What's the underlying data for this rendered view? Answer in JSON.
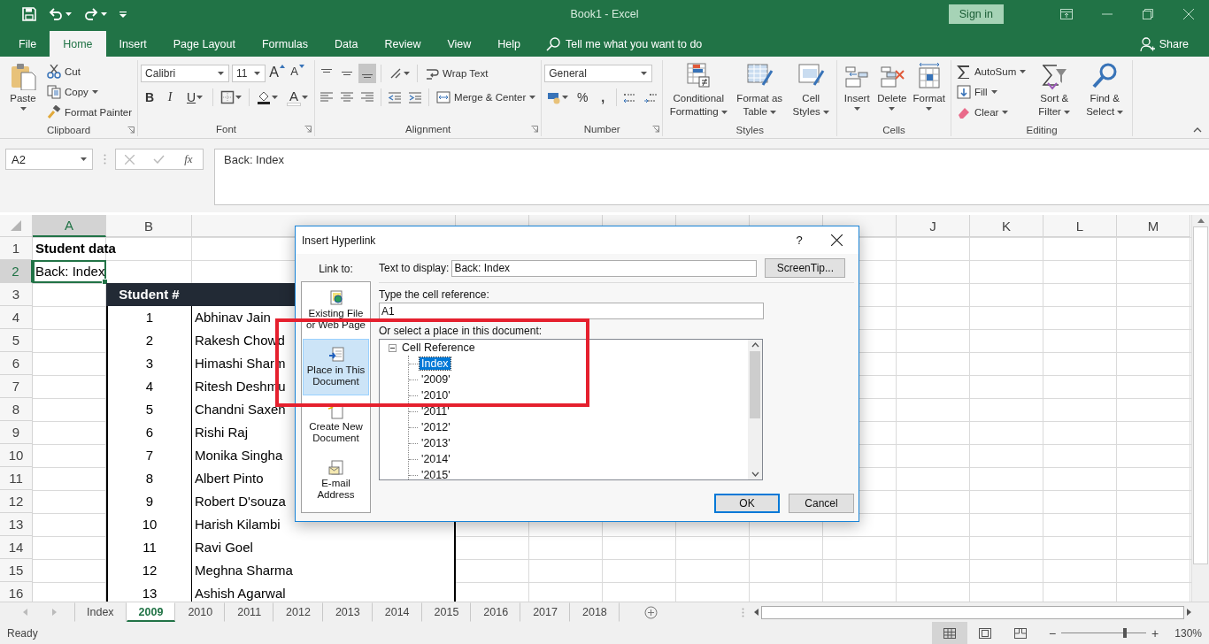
{
  "window": {
    "title": "Book1  -  Excel",
    "sign_in": "Sign in"
  },
  "menu_tabs": [
    {
      "label": "File",
      "selected": false
    },
    {
      "label": "Home",
      "selected": true
    },
    {
      "label": "Insert",
      "selected": false
    },
    {
      "label": "Page Layout",
      "selected": false
    },
    {
      "label": "Formulas",
      "selected": false
    },
    {
      "label": "Data",
      "selected": false
    },
    {
      "label": "Review",
      "selected": false
    },
    {
      "label": "View",
      "selected": false
    },
    {
      "label": "Help",
      "selected": false
    }
  ],
  "tell_me": {
    "placeholder": "Tell me what you want to do"
  },
  "share": "Share",
  "ribbon": {
    "clipboard": {
      "label": "Clipboard",
      "paste": "Paste",
      "cut": "Cut",
      "copy": "Copy",
      "format_painter": "Format Painter"
    },
    "font": {
      "label": "Font",
      "font_name": "Calibri",
      "font_size": "11",
      "grow": "A",
      "shrink": "A",
      "bold": "B",
      "italic": "I",
      "underline": "U",
      "font_color": "A"
    },
    "alignment": {
      "label": "Alignment",
      "vertical_align": [
        {
          "selected": false
        },
        {
          "selected": false
        },
        {
          "selected": true
        }
      ],
      "wrap_text": "Wrap Text",
      "merge_center": "Merge & Center"
    },
    "number": {
      "label": "Number",
      "format": "General",
      "percent": "%",
      "comma": ","
    },
    "styles": {
      "label": "Styles",
      "buttons": [
        "Conditional Formatting",
        "Format as Table",
        "Cell Styles"
      ]
    },
    "cells": {
      "label": "Cells",
      "buttons": [
        "Insert",
        "Delete",
        "Format"
      ]
    },
    "editing": {
      "label": "Editing",
      "autosum": "AutoSum",
      "fill": "Fill",
      "clear": "Clear",
      "buttons": [
        "Sort & Filter",
        "Find & Select"
      ]
    }
  },
  "formula_bar": {
    "name_box": "A2",
    "function_label": "fx",
    "value": "Back: Index"
  },
  "sheet": {
    "columns": [
      {
        "label": "A",
        "selected": true
      },
      {
        "label": "B",
        "selected": false
      },
      {
        "selected": false
      },
      {
        "selected": false
      },
      {
        "selected": false
      },
      {
        "selected": false
      },
      {
        "selected": false
      },
      {
        "selected": false
      },
      {
        "selected": false
      },
      {
        "label": "J",
        "selected": false
      },
      {
        "label": "K",
        "selected": false
      },
      {
        "label": "L",
        "selected": false
      },
      {
        "label": "M",
        "selected": false
      }
    ],
    "rows": [
      {
        "header": "1",
        "selected": false,
        "kind": "title",
        "a": {
          "text": "Student data",
          "selected": false
        }
      },
      {
        "header": "2",
        "selected": true,
        "kind": "plain",
        "a": {
          "text": "Back: Index",
          "selected": true
        }
      },
      {
        "header": "3",
        "selected": false,
        "kind": "table-header",
        "b": {
          "text": "Student #",
          "selected": false
        }
      },
      {
        "header": "4",
        "selected": false,
        "kind": "table-row",
        "b": {
          "text": "1",
          "selected": false
        },
        "c": {
          "text": "Abhinav Jain",
          "selected": false
        }
      },
      {
        "header": "5",
        "selected": false,
        "kind": "table-row",
        "b": {
          "text": "2",
          "selected": false
        },
        "c": {
          "text": "Rakesh Chowd",
          "selected": false
        }
      },
      {
        "header": "6",
        "selected": false,
        "kind": "table-row",
        "b": {
          "text": "3",
          "selected": false
        },
        "c": {
          "text": "Himashi Sharm",
          "selected": false
        }
      },
      {
        "header": "7",
        "selected": false,
        "kind": "table-row",
        "b": {
          "text": "4",
          "selected": false
        },
        "c": {
          "text": "Ritesh Deshmu",
          "selected": false
        }
      },
      {
        "header": "8",
        "selected": false,
        "kind": "table-row",
        "b": {
          "text": "5",
          "selected": false
        },
        "c": {
          "text": "Chandni Saxen",
          "selected": false
        }
      },
      {
        "header": "9",
        "selected": false,
        "kind": "table-row",
        "b": {
          "text": "6",
          "selected": false
        },
        "c": {
          "text": "Rishi Raj",
          "selected": false
        }
      },
      {
        "header": "10",
        "selected": false,
        "kind": "table-row",
        "b": {
          "text": "7",
          "selected": false
        },
        "c": {
          "text": "Monika Singha",
          "selected": false
        }
      },
      {
        "header": "11",
        "selected": false,
        "kind": "table-row",
        "b": {
          "text": "8",
          "selected": false
        },
        "c": {
          "text": "Albert Pinto",
          "selected": false
        }
      },
      {
        "header": "12",
        "selected": false,
        "kind": "table-row",
        "b": {
          "text": "9",
          "selected": false
        },
        "c": {
          "text": "Robert D'souza",
          "selected": false
        }
      },
      {
        "header": "13",
        "selected": false,
        "kind": "table-row",
        "b": {
          "text": "10",
          "selected": false
        },
        "c": {
          "text": "Harish Kilambi",
          "selected": false
        }
      },
      {
        "header": "14",
        "selected": false,
        "kind": "table-row",
        "b": {
          "text": "11",
          "selected": false
        },
        "c": {
          "text": "Ravi Goel",
          "selected": false
        }
      },
      {
        "header": "15",
        "selected": false,
        "kind": "table-row",
        "b": {
          "text": "12",
          "selected": false
        },
        "c": {
          "text": "Meghna Sharma",
          "selected": false
        }
      },
      {
        "header": "16",
        "selected": false,
        "kind": "table-row",
        "b": {
          "text": "13",
          "selected": false
        },
        "c": {
          "text": "Ashish Agarwal",
          "selected": false
        }
      }
    ]
  },
  "dialog": {
    "title": "Insert Hyperlink",
    "help": "?",
    "link_to": {
      "label": "Link to:",
      "items": [
        {
          "label": "Existing File or Web Page",
          "selected": false
        },
        {
          "label": "Place in This Document",
          "selected": true
        },
        {
          "label": "Create New Document",
          "selected": false
        },
        {
          "label": "E-mail Address",
          "selected": false
        }
      ]
    },
    "text_to_display": {
      "label": "Text to display:",
      "value": "Back: Index"
    },
    "screentip": "ScreenTip...",
    "cell_reference": {
      "label": "Type the cell reference:",
      "value": "A1"
    },
    "place_label": "Or select a place in this document:",
    "places": {
      "label": "Cell Reference",
      "expanded": true,
      "children": [
        {
          "label": "Index",
          "selected": true
        },
        {
          "label": "'2009'",
          "selected": false
        },
        {
          "label": "'2010'",
          "selected": false
        },
        {
          "label": "'2011'",
          "selected": false
        },
        {
          "label": "'2012'",
          "selected": false
        },
        {
          "label": "'2013'",
          "selected": false
        },
        {
          "label": "'2014'",
          "selected": false
        },
        {
          "label": "'2015'",
          "selected": false
        }
      ]
    },
    "buttons": [
      {
        "label": "OK",
        "default": true
      },
      {
        "label": "Cancel",
        "default": false
      }
    ]
  },
  "sheet_tabs": [
    {
      "label": "Index",
      "selected": false
    },
    {
      "label": "2009",
      "selected": true
    },
    {
      "label": "2010",
      "selected": false
    },
    {
      "label": "2011",
      "selected": false
    },
    {
      "label": "2012",
      "selected": false
    },
    {
      "label": "2013",
      "selected": false
    },
    {
      "label": "2014",
      "selected": false
    },
    {
      "label": "2015",
      "selected": false
    },
    {
      "label": "2016",
      "selected": false
    },
    {
      "label": "2017",
      "selected": false
    },
    {
      "label": "2018",
      "selected": false
    }
  ],
  "status_bar": {
    "status": "Ready",
    "views": [
      {
        "selected": true
      },
      {
        "selected": false
      },
      {
        "selected": false
      }
    ],
    "zoom": {
      "zoom_out": "−",
      "zoom_in": "+",
      "level": 0.75,
      "reading": "130%"
    }
  }
}
